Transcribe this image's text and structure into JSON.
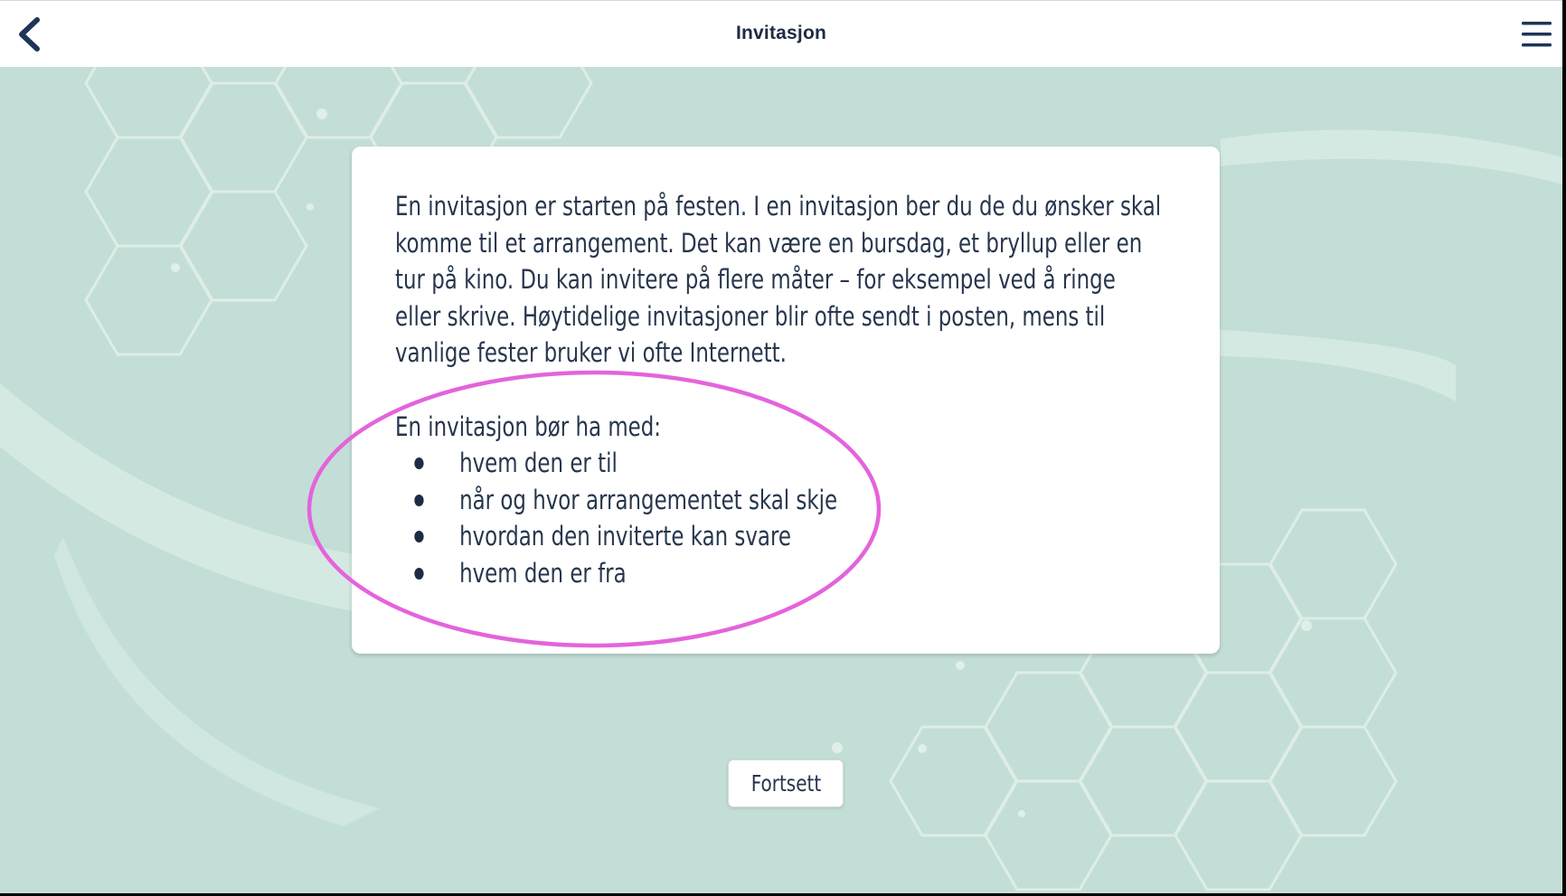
{
  "header": {
    "title": "Invitasjon",
    "back_icon": "chevron-left-icon",
    "menu_icon": "hamburger-menu-icon"
  },
  "content": {
    "paragraph": "En invitasjon er starten på festen. I en invitasjon ber du de du ønsker skal komme til et arrangement. Det kan være en bursdag, et bryllup eller en tur på kino. Du kan invitere på flere måter – for eksempel ved å ringe eller skrive. Høytidelige invitasjoner blir ofte sendt i posten, mens til vanlige fester bruker vi ofte Internett.",
    "list_intro": "En invitasjon bør ha med:",
    "list_items": [
      "hvem den er til",
      "når og hvor arrangementet skal skje",
      "hvordan den inviterte kan svare",
      "hvem den er fra"
    ]
  },
  "footer": {
    "continue_label": "Fortsett"
  },
  "colors": {
    "background": "#c3ded6",
    "text": "#27364d",
    "annotation_circle": "#e463dc"
  }
}
